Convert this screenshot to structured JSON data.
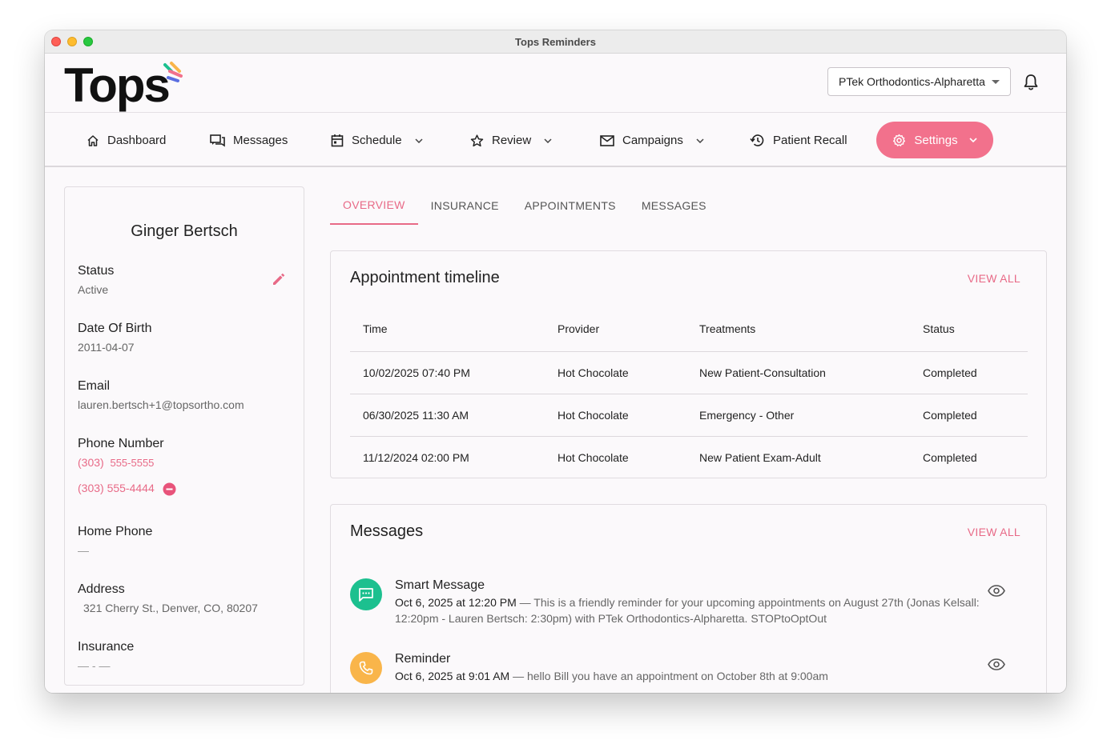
{
  "window": {
    "title": "Tops Reminders"
  },
  "brand": {
    "logo_text": "Tops",
    "accent": "#f2718c",
    "link_color": "#e86a87"
  },
  "header": {
    "location": "PTek Orthodontics-Alpharetta"
  },
  "nav": {
    "dashboard": "Dashboard",
    "messages": "Messages",
    "schedule": "Schedule",
    "review": "Review",
    "campaigns": "Campaigns",
    "patient_recall": "Patient Recall",
    "settings": "Settings"
  },
  "profile": {
    "name": "Ginger Bertsch",
    "status_label": "Status",
    "status_value": "Active",
    "dob_label": "Date Of Birth",
    "dob_value": "2011-04-07",
    "email_label": "Email",
    "email_value": "lauren.bertsch+1@topsortho.com",
    "phone_label": "Phone Number",
    "phone_1_area": "(303)",
    "phone_1_number": "555-5555",
    "phone_2": "(303) 555-4444",
    "home_phone_label": "Home Phone",
    "home_phone_value": "—",
    "address_label": "Address",
    "address_value": "321 Cherry St., Denver, CO, 80207",
    "insurance_label": "Insurance",
    "insurance_value": "— - —"
  },
  "tabs": [
    "OVERVIEW",
    "INSURANCE",
    "APPOINTMENTS",
    "MESSAGES"
  ],
  "appointments": {
    "title": "Appointment timeline",
    "view_all": "VIEW ALL",
    "columns": [
      "Time",
      "Provider",
      "Treatments",
      "Status"
    ],
    "rows": [
      [
        "10/02/2025 07:40 PM",
        "Hot Chocolate",
        "New Patient-Consultation",
        "Completed"
      ],
      [
        "06/30/2025 11:30 AM",
        "Hot Chocolate",
        "Emergency - Other",
        "Completed"
      ],
      [
        "11/12/2024 02:00 PM",
        "Hot Chocolate",
        "New Patient Exam-Adult",
        "Completed"
      ]
    ]
  },
  "messages": {
    "title": "Messages",
    "view_all": "VIEW ALL",
    "items": [
      {
        "type": "Smart Message",
        "date": "Oct 6, 2025 at 12:20 PM",
        "separator": " — ",
        "text": "This is a friendly reminder for your upcoming appointments on August 27th (Jonas Kelsall: 12:20pm - Lauren Bertsch: 2:30pm) with PTek Orthodontics-Alpharetta. STOPtoOptOut",
        "icon": "chat-bubble-icon",
        "color": "#1cc08f"
      },
      {
        "type": "Reminder",
        "date": "Oct 6, 2025 at 9:01 AM",
        "separator": " — ",
        "text": "hello Bill you have an appointment on October 8th at 9:00am",
        "icon": "phone-icon",
        "color": "#f9b54a"
      }
    ]
  }
}
